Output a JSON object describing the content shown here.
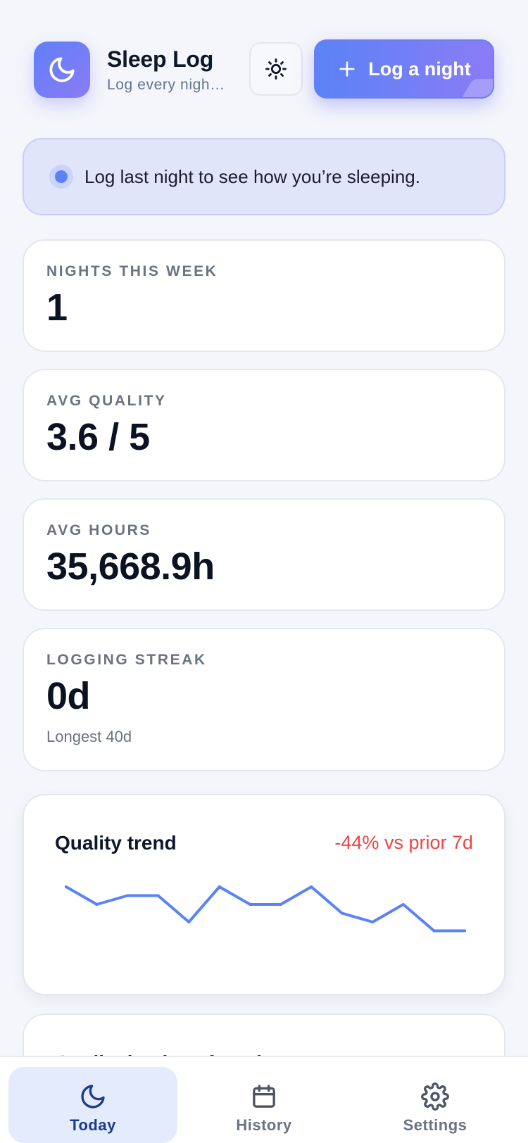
{
  "header": {
    "title": "Sleep Log",
    "subtitle": "Log every nigh…",
    "app_icon": "moon-icon",
    "theme_icon": "sun-icon",
    "log_button_label": "Log a night",
    "log_button_icon": "plus-icon"
  },
  "banner": {
    "text": "Log last night to see how you’re sleeping."
  },
  "stats": [
    {
      "label": "NIGHTS THIS WEEK",
      "value": "1"
    },
    {
      "label": "AVG QUALITY",
      "value": "3.6 / 5"
    },
    {
      "label": "AVG HOURS",
      "value": "35,668.9h"
    },
    {
      "label": "LOGGING STREAK",
      "value": "0d",
      "sub": "Longest 40d"
    }
  ],
  "trend": {
    "title": "Quality trend",
    "delta": "-44% vs prior 7d",
    "delta_color": "#ef4444",
    "line_color": "#5b82f6"
  },
  "chart_data": {
    "type": "line",
    "title": "Quality trend",
    "x": [
      1,
      2,
      3,
      4,
      5,
      6,
      7,
      8,
      9,
      10,
      11,
      12,
      13,
      14
    ],
    "values": [
      5,
      4,
      4.5,
      4.5,
      3,
      5,
      4,
      4,
      5,
      3.5,
      3,
      4,
      2.5,
      2.5
    ],
    "ylim": [
      1,
      5
    ],
    "grid": false,
    "legend": "none"
  },
  "next_card": {
    "title": "Quality by day of week"
  },
  "nav": {
    "items": [
      {
        "label": "Today",
        "icon": "moon-icon",
        "active": true
      },
      {
        "label": "History",
        "icon": "calendar-icon",
        "active": false
      },
      {
        "label": "Settings",
        "icon": "gear-icon",
        "active": false
      }
    ]
  },
  "colors": {
    "accent": "#5b82f6",
    "accent_secondary": "#8a7cf6",
    "background": "#f4f6fb"
  }
}
